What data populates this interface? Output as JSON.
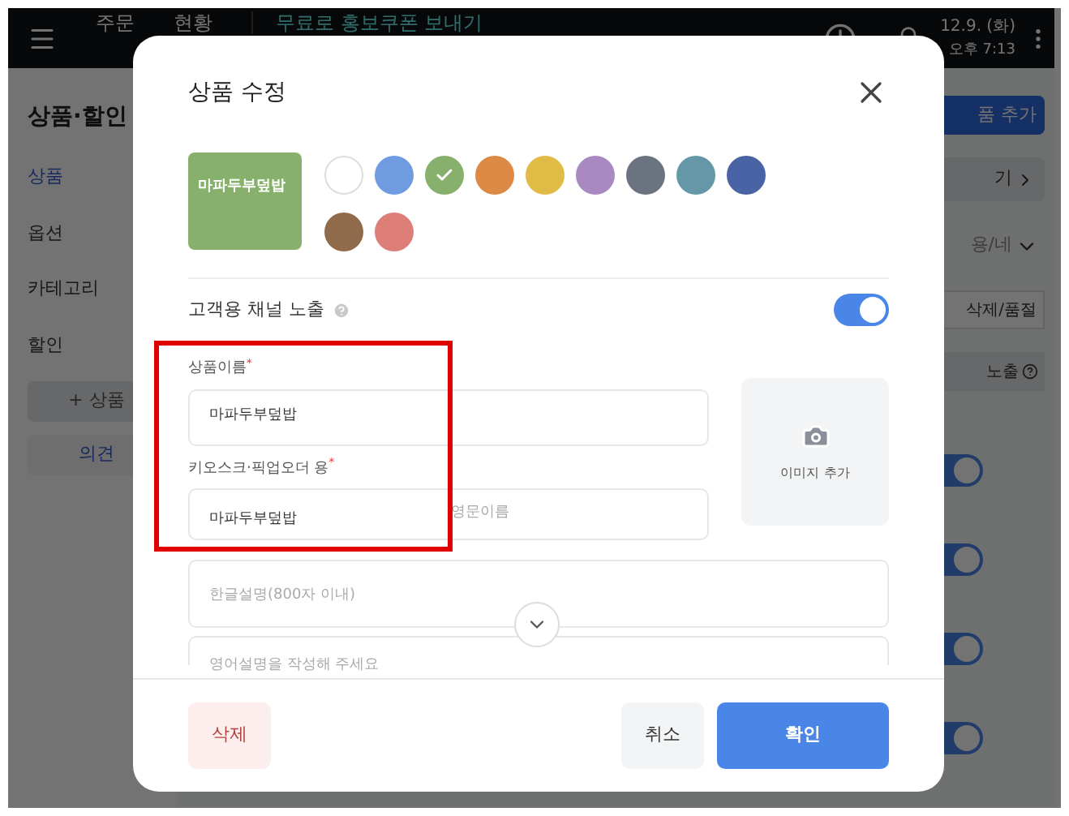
{
  "top_bar": {
    "tabs": [
      {
        "label": "주문",
        "selected": false
      },
      {
        "label": "현황",
        "selected": false
      }
    ],
    "promo_link": "무료로 홍보쿠폰 보내기",
    "date": "12.9. (화)",
    "time": "오후 7:13"
  },
  "sidebar": {
    "title": "상품·할인",
    "items": [
      {
        "label": "상품",
        "selected": true
      },
      {
        "label": "옵션",
        "selected": false
      },
      {
        "label": "카테고리",
        "selected": false
      },
      {
        "label": "할인",
        "selected": false
      }
    ],
    "add_button": "+ 상품",
    "feedback_button": "의견"
  },
  "main": {
    "add_button": "품 추가",
    "link": "기",
    "filter": "용/네",
    "column_headers": [
      "삭제/품절",
      "노출"
    ],
    "toggles": [
      {
        "on": true
      },
      {
        "on": true
      },
      {
        "on": true
      },
      {
        "on": true
      }
    ]
  },
  "modal": {
    "title": "상품 수정",
    "preview": {
      "label": "마파두부덮밥",
      "color": "#86b06b"
    },
    "colors": [
      {
        "color": "#ffffff",
        "selected": false
      },
      {
        "color": "#6f9be0",
        "selected": false
      },
      {
        "color": "#86b06b",
        "selected": true
      },
      {
        "color": "#dc8a45",
        "selected": false
      },
      {
        "color": "#e0bb45",
        "selected": false
      },
      {
        "color": "#a989c0",
        "selected": false
      },
      {
        "color": "#6b7280",
        "selected": false
      },
      {
        "color": "#6497a8",
        "selected": false
      },
      {
        "color": "#4a63a5",
        "selected": false
      },
      {
        "color": "#8f6b4c",
        "selected": false
      },
      {
        "color": "#dd7f78",
        "selected": false
      }
    ],
    "channel_toggle": {
      "label": "고객용 채널 노출",
      "on": true
    },
    "name_field": {
      "label": "상품이름",
      "required_mark": "*",
      "value": "마파두부덮밥"
    },
    "kiosk_field": {
      "label": "키오스크·픽업오더 용",
      "required_mark": "*",
      "value": "마파두부덮밥",
      "english_placeholder": "영문이름"
    },
    "image_button": "이미지 추가",
    "description_ko": {
      "placeholder": "한글설명(800자 이내)"
    },
    "description_en": {
      "placeholder": "영어설명을 작성해 주세요"
    },
    "buttons": {
      "delete": "삭제",
      "cancel": "취소",
      "confirm": "확인"
    }
  }
}
